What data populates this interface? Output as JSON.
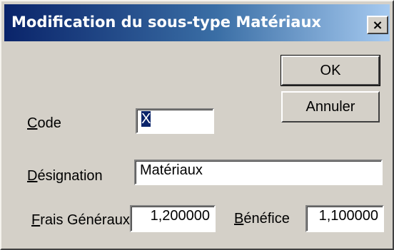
{
  "window": {
    "title": "Modification du sous-type Matériaux",
    "close_label": "×"
  },
  "buttons": {
    "ok_label": "OK",
    "cancel_label": "Annuler"
  },
  "form": {
    "code": {
      "access_key": "C",
      "label_rest": "ode",
      "value": "X"
    },
    "designation": {
      "access_key": "D",
      "label_rest": "ésignation",
      "value": "Matériaux"
    },
    "frais_generaux": {
      "access_key": "F",
      "label_rest": "rais Généraux",
      "value": "1,200000"
    },
    "benefice": {
      "access_key": "B",
      "label_rest": "énéfice",
      "value": "1,100000"
    }
  },
  "colors": {
    "title_start": "#0a246a",
    "title_end": "#a6caf0",
    "dialog_bg": "#d4d0c8"
  }
}
